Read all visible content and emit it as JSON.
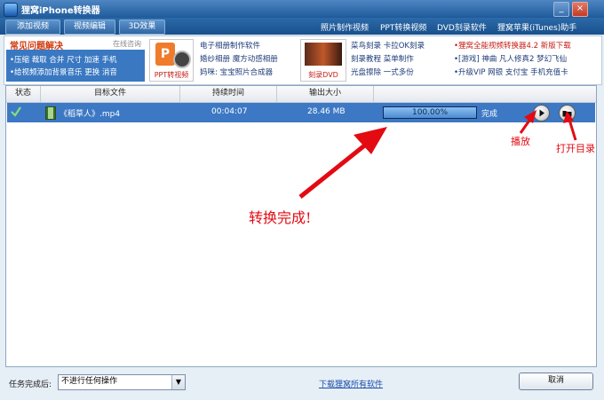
{
  "window": {
    "title": "狸窝iPhone转换器"
  },
  "toolbar": {
    "buttons": [
      "添加视频",
      "视频编辑",
      "3D效果"
    ],
    "links": [
      "照片制作视频",
      "PPT转换视频",
      "DVD刻录软件",
      "狸窝苹果(iTunes)助手"
    ]
  },
  "ads": {
    "faq_title": "常见问题解决",
    "faq_online": "在线咨询",
    "faq_line1": "•压缩 裁取 合并 尺寸 加速 手机",
    "faq_line2": "•给视频添加背景音乐 更换 消音",
    "ppt_caption": "PPT转视频",
    "col1": [
      "电子相册制作软件",
      "婚纱相册 魔方动感相册",
      "妈咪: 宝宝照片合成器"
    ],
    "dvd_caption": "刻录DVD",
    "col2": [
      "菜鸟刻录 卡拉OK刻录",
      "刻录教程 菜单制作",
      "光盘擦除 一式多份"
    ],
    "col3a": "•狸窝全能视频转换器4.2 新版下载",
    "col3b": "•[游戏] 神曲 凡人修真2 梦幻飞仙",
    "col3c": "•升级VIP 网银 支付宝 手机充值卡"
  },
  "table": {
    "columns": [
      "状态",
      "目标文件",
      "持续时间",
      "输出大小"
    ],
    "rows": [
      {
        "status_icon": "checkmark-icon",
        "file": "《稻草人》.mp4",
        "duration": "00:04:07",
        "size": "28.46 MB",
        "progress": 100,
        "progress_label": "100.00%",
        "state": "完成"
      }
    ]
  },
  "annotations": {
    "play": "播放",
    "open_dir": "打开目录",
    "done": "转换完成!"
  },
  "status": {
    "after_label": "任务完成后:",
    "after_value": "不进行任何操作",
    "download_link": "下载狸窝所有软件",
    "cancel": "取消"
  },
  "colors": {
    "selected_row": "#3d78c4",
    "annotation": "#e30a12",
    "title_bar": "#1f5a9b"
  }
}
